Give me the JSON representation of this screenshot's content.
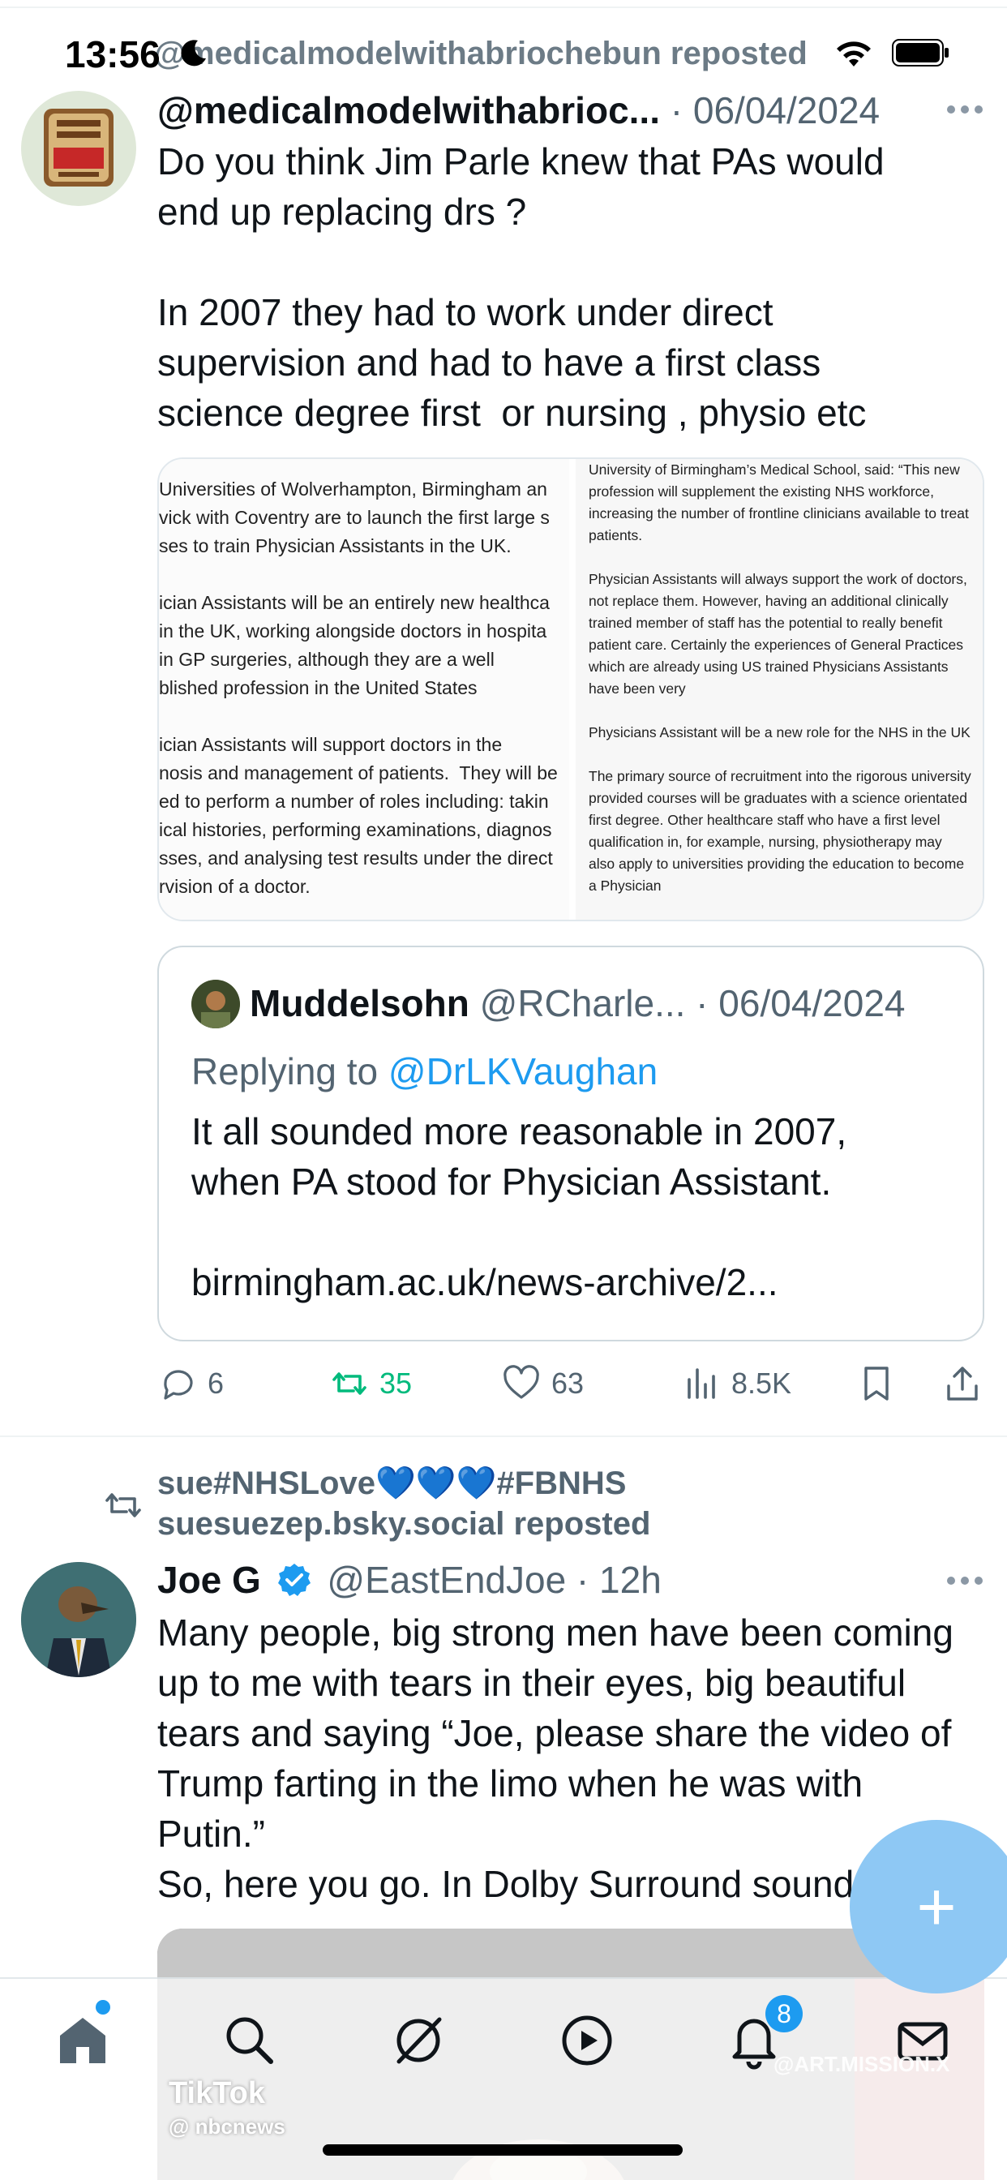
{
  "status_bar": {
    "time": "13:56",
    "icons": [
      "moon-icon",
      "wifi-icon",
      "battery-icon"
    ]
  },
  "overlay_repost": "@medicalmodelwithabriochebun reposted",
  "tweet1": {
    "display_name": "@medicalmodelwithabrioc...",
    "date": "· 06/04/2024",
    "text": "Do you think Jim Parle knew that PAs would\nend up replacing drs ?\n\nIn 2007 they had to work under direct\nsupervision and had to have a first class\nscience degree first  or nursing , physio etc",
    "avatar_label": "General Medical Council",
    "media_left": "Universities of Wolverhampton, Birmingham an\nvick with Coventry are to launch the first large s\nses to train Physician Assistants in the UK.\n\nician Assistants will be an entirely new healthca\nin the UK, working alongside doctors in hospita\nin GP surgeries, although they are a well\nblished profession in the United States\n\nician Assistants will support doctors in the\nnosis and management of patients.  They will be\ned to perform a number of roles including: takin\nical histories, performing examinations, diagnos\nsses, and analysing test results under the direct\nrvision of a doctor.",
    "media_right": "University of Birmingham’s Medical School, said: “This new profession will supplement the existing NHS workforce, increasing the number of frontline clinicians available to treat patients.\n\nPhysician Assistants will always support the work of doctors, not replace them. However, having an additional clinically trained member of staff has the potential to really benefit patient care. Certainly the experiences of General Practices which are already using US trained Physicians Assistants have been very\n\nPhysicians Assistant will be a new role for the NHS in the UK\n\nThe primary source of recruitment into the rigorous university provided courses will be graduates with a science orientated first degree. Other healthcare staff who have a first level qualification in, for example, nursing, physiotherapy may also apply to universities providing the education to become a Physician",
    "quote": {
      "name": "Muddelsohn",
      "handle_date": "@RCharle... · 06/04/2024",
      "replying_to_label": "Replying to ",
      "replying_to_handle": "@DrLKVaughan",
      "text": "It all sounded more reasonable in 2007,\nwhen PA stood for Physician Assistant.\n\nbirmingham.ac.uk/news-archive/2..."
    },
    "actions": {
      "replies": "6",
      "reposts": "35",
      "likes": "63",
      "views": "8.5K"
    }
  },
  "tweet2": {
    "repost_line1": "sue#NHSLove💙💙💙#FBNHS",
    "repost_line2": "suesuezep.bsky.social reposted",
    "display_name": "Joe G",
    "handle_time": "@EastEndJoe · 12h",
    "text": "Many people, big strong men have been coming\nup to me with tears in their eyes, big beautiful\ntears and saying “Joe, please share the video of\nTrump farting in the limo when he was with\nPutin.”\nSo, here you go. In Dolby Surround sound.",
    "video_watermark_1": "TikTok",
    "video_watermark_2": "@ nbcnews",
    "video_watermark_3": "@ART.MISSION.X"
  },
  "fab_label": "+",
  "tabbar": {
    "items": [
      "home-icon",
      "search-icon",
      "grok-icon",
      "video-icon",
      "notifications-icon",
      "messages-icon"
    ],
    "notification_count": "8"
  },
  "colors": {
    "accent": "#1d9bf0",
    "repost_green": "#00ba7c",
    "gray_text": "#536471"
  }
}
